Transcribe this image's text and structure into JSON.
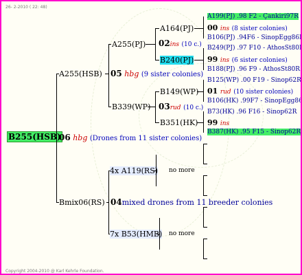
{
  "header": "26- 2-2010 ( 22: 48)",
  "copyright": "Copyright 2004-2010 @ Karl Kehrle Foundation.",
  "root": {
    "id": "B255(HSB)",
    "year": "06",
    "race": "hbg",
    "note": "(Drones from 11 sister colonies)"
  },
  "queen_line": {
    "id": "A255(HSB)",
    "year": "05",
    "race": "hbg",
    "note": "(9 sister colonies)",
    "dam": {
      "id": "A255(PJ)",
      "year": "02",
      "race": "ins",
      "note": "(10 c.)",
      "dam": {
        "id": "A164(PJ)",
        "year": "00",
        "race": "ins",
        "note": "(8 sister colonies)",
        "dam": "A199(PJ) .98   F2 - Çankiri97R",
        "sire": "B106(PJ) .94F6 - SinopEgg86R"
      },
      "sire": {
        "id": "B240(PJ)",
        "year": "99",
        "race": "ins",
        "note": "(6 sister colonies)",
        "dam": "B249(PJ) .97 F10 - AthosSt80R",
        "sire": "B188(PJ) .96   F9 - AthosSt80R"
      }
    },
    "sire": {
      "id": "B339(WP)",
      "year": "03",
      "race": "rud",
      "note": "(10 c.)",
      "dam": {
        "id": "B149(WP)",
        "year": "01",
        "race": "rud",
        "note": "(10 sister colonies)",
        "dam": "B125(WP) .00  F19 - Sinop62R",
        "sire": "B106(HK) .99F7 - SinopEgg86R"
      },
      "sire": {
        "id": "B351(HK)",
        "year": "99",
        "race": "ins",
        "note": "",
        "dam": "B73(HK) .96     F16 - Sinop62R",
        "sire": "B387(HK) .95  F15 - Sinop62R"
      }
    }
  },
  "drone_line": {
    "id": "Bmix06(RS)",
    "year": "04",
    "note": "mixed drones from 11 breeder colonies",
    "a": {
      "label": "4x A119(RS)",
      "more": "no more"
    },
    "b": {
      "label": "7x B53(HMB)",
      "more": "no more"
    }
  }
}
